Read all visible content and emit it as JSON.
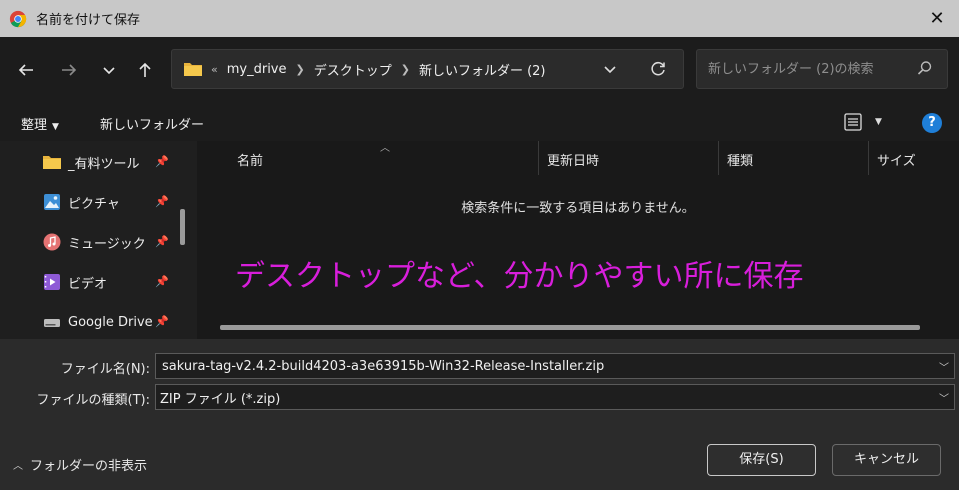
{
  "window": {
    "title": "名前を付けて保存",
    "close": "✕"
  },
  "address": {
    "overflow": "«",
    "segments": [
      "my_drive",
      "デスクトップ",
      "新しいフォルダー (2)"
    ]
  },
  "search": {
    "placeholder": "新しいフォルダー (2)の検索"
  },
  "toolbar": {
    "organize_label": "整理",
    "new_folder_label": "新しいフォルダー",
    "help_label": "?"
  },
  "sidebar": {
    "items": [
      {
        "label": "_有料ツール",
        "icon": "folder-icon"
      },
      {
        "label": "ピクチャ",
        "icon": "pictures-icon"
      },
      {
        "label": "ミュージック",
        "icon": "music-icon"
      },
      {
        "label": "ビデオ",
        "icon": "video-icon"
      },
      {
        "label": "Google Drive",
        "icon": "drive-icon"
      }
    ]
  },
  "filelist": {
    "columns": [
      "名前",
      "更新日時",
      "種類",
      "サイズ"
    ],
    "empty_message": "検索条件に一致する項目はありません。"
  },
  "annotation": {
    "text": "デスクトップなど、分かりやすい所に保存",
    "color": "#d81edb"
  },
  "form": {
    "filename_label": "ファイル名(N):",
    "filename_value": "sakura-tag-v2.4.2-build4203-a3e63915b-Win32-Release-Installer.zip",
    "filetype_label": "ファイルの種類(T):",
    "filetype_value": "ZIP ファイル (*.zip)"
  },
  "footer": {
    "hide_folders_label": "フォルダーの非表示",
    "save_label": "保存(S)",
    "cancel_label": "キャンセル"
  }
}
